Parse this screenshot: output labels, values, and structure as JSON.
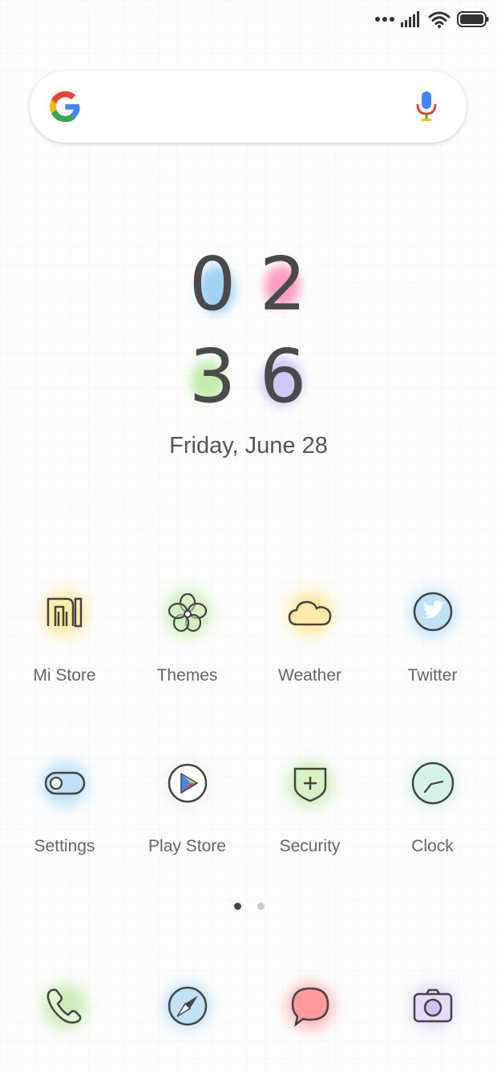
{
  "clock": {
    "h1": "0",
    "h2": "2",
    "m1": "3",
    "m2": "6"
  },
  "date": "Friday, June 28",
  "apps_row1": [
    {
      "label": "Mi Store",
      "icon": "mi-store-icon",
      "glow": "#ffe27a"
    },
    {
      "label": "Themes",
      "icon": "flower-icon",
      "glow": "#b8e59a"
    },
    {
      "label": "Weather",
      "icon": "cloud-icon",
      "glow": "#ffe27a"
    },
    {
      "label": "Twitter",
      "icon": "twitter-bird-icon",
      "glow": "#9fd3f5"
    }
  ],
  "apps_row2": [
    {
      "label": "Settings",
      "icon": "toggle-icon",
      "glow": "#9fd3f5"
    },
    {
      "label": "Play Store",
      "icon": "play-triangle-icon",
      "glow": "#ffffff"
    },
    {
      "label": "Security",
      "icon": "shield-icon",
      "glow": "#b8e59a"
    },
    {
      "label": "Clock",
      "icon": "clock-icon",
      "glow": "#b7ead6"
    }
  ],
  "dock": [
    {
      "icon": "phone-icon",
      "glow": "#b8e59a"
    },
    {
      "icon": "compass-icon",
      "glow": "#9fd3f5"
    },
    {
      "icon": "message-icon",
      "glow": "#ff8a8a"
    },
    {
      "icon": "camera-icon",
      "glow": "#d5c8f5"
    }
  ],
  "page_indicator": {
    "pages": 2,
    "current": 1
  }
}
